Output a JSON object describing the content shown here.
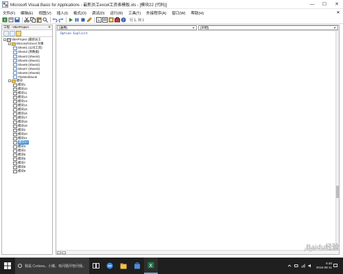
{
  "window": {
    "title": "Microsoft Visual Basic for Applications - 最新员工excel工资表模板.xls - [模块22 (代码)]"
  },
  "menu": {
    "items": [
      "文件(F)",
      "编辑(E)",
      "视图(V)",
      "插入(I)",
      "格式(O)",
      "调试(D)",
      "运行(R)",
      "工具(T)",
      "外接程序(A)",
      "窗口(W)",
      "帮助(H)"
    ]
  },
  "toolbar": {
    "position": "行 1, 列 1"
  },
  "project_panel": {
    "title": "工程 - VBAProject",
    "tree": [
      {
        "label": "VBAProject (最新员工",
        "level": 0,
        "type": "project",
        "twisty": "-"
      },
      {
        "label": "Microsoft Excel 对象",
        "level": 1,
        "type": "folder",
        "twisty": "-"
      },
      {
        "label": "Sheet1 (公司工资)",
        "level": 2,
        "type": "sheet"
      },
      {
        "label": "Sheet2 (原数据)",
        "level": 2,
        "type": "sheet"
      },
      {
        "label": "Sheet3 (Sheet4)",
        "level": 2,
        "type": "sheet"
      },
      {
        "label": "Sheet5 (Sheet1)",
        "level": 2,
        "type": "sheet"
      },
      {
        "label": "Sheet6 (Sheet2)",
        "level": 2,
        "type": "sheet"
      },
      {
        "label": "Sheet7 (Sheet3)",
        "level": 2,
        "type": "sheet"
      },
      {
        "label": "Sheet8 (Sheet5)",
        "level": 2,
        "type": "sheet"
      },
      {
        "label": "ThisWorkbook",
        "level": 2,
        "type": "sheet"
      },
      {
        "label": "模块",
        "level": 1,
        "type": "folder",
        "twisty": "-"
      },
      {
        "label": "模块1",
        "level": 2,
        "type": "module"
      },
      {
        "label": "模块10",
        "level": 2,
        "type": "module"
      },
      {
        "label": "模块11",
        "level": 2,
        "type": "module"
      },
      {
        "label": "模块12",
        "level": 2,
        "type": "module"
      },
      {
        "label": "模块13",
        "level": 2,
        "type": "module"
      },
      {
        "label": "模块14",
        "level": 2,
        "type": "module"
      },
      {
        "label": "模块15",
        "level": 2,
        "type": "module"
      },
      {
        "label": "模块16",
        "level": 2,
        "type": "module"
      },
      {
        "label": "模块17",
        "level": 2,
        "type": "module"
      },
      {
        "label": "模块18",
        "level": 2,
        "type": "module"
      },
      {
        "label": "模块19",
        "level": 2,
        "type": "module"
      },
      {
        "label": "模块2",
        "level": 2,
        "type": "module"
      },
      {
        "label": "模块20",
        "level": 2,
        "type": "module"
      },
      {
        "label": "模块21",
        "level": 2,
        "type": "module"
      },
      {
        "label": "模块22",
        "level": 2,
        "type": "module",
        "selected": true
      },
      {
        "label": "模块3",
        "level": 2,
        "type": "module"
      },
      {
        "label": "模块4",
        "level": 2,
        "type": "module"
      },
      {
        "label": "模块5",
        "level": 2,
        "type": "module"
      },
      {
        "label": "模块6",
        "level": 2,
        "type": "module"
      },
      {
        "label": "模块7",
        "level": 2,
        "type": "module"
      },
      {
        "label": "模块8",
        "level": 2,
        "type": "module"
      },
      {
        "label": "模块9",
        "level": 2,
        "type": "module"
      }
    ]
  },
  "code_window": {
    "object_combo": "(通用)",
    "procedure_combo": "(声明)",
    "code_lines": [
      "Option Explicit"
    ]
  },
  "taskbar": {
    "search_placeholder": "我是 Cortana，小娜。有问题尽管问我。",
    "time": "9:48",
    "date": "2016-08-11"
  },
  "watermark": {
    "brand": "Baidu经验",
    "url": "jingyan.baidu.com"
  },
  "colors": {
    "selection": "#3b8fd9",
    "code_text": "#1a3a9a",
    "taskbar": "#1f1f1f"
  }
}
